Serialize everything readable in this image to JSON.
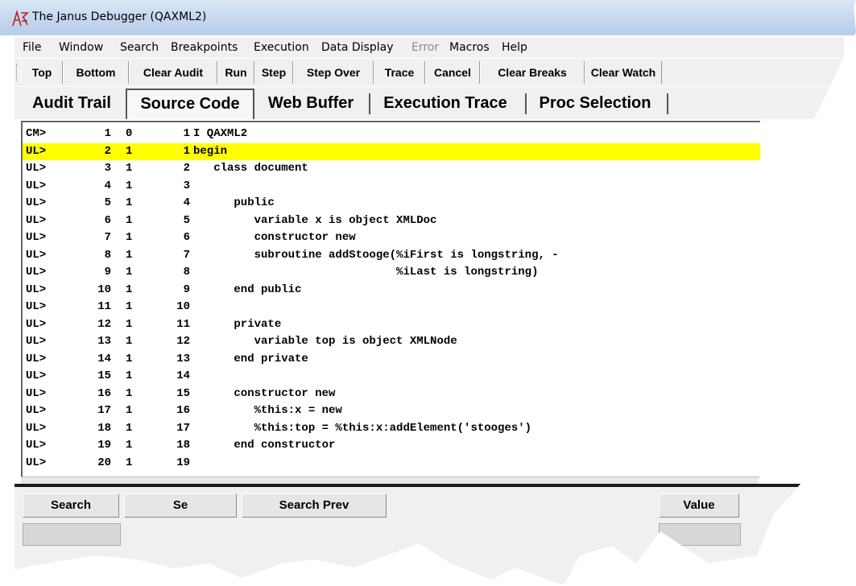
{
  "window": {
    "title": "The Janus Debugger (QAXML2)",
    "icon": "janus-debugger-icon"
  },
  "menu": [
    {
      "label": "File",
      "enabled": true
    },
    {
      "label": "Window",
      "enabled": true
    },
    {
      "label": "Search",
      "enabled": true
    },
    {
      "label": "Breakpoints",
      "enabled": true
    },
    {
      "label": "Execution",
      "enabled": true
    },
    {
      "label": "Data Display",
      "enabled": true
    },
    {
      "label": "Error",
      "enabled": false
    },
    {
      "label": "Macros",
      "enabled": true
    },
    {
      "label": "Help",
      "enabled": true
    }
  ],
  "toolbar": [
    "Top",
    "Bottom",
    "Clear Audit",
    "Run",
    "Step",
    "Step Over",
    "Trace",
    "Cancel",
    "Clear Breaks",
    "Clear Watch"
  ],
  "tabs": {
    "items": [
      "Audit Trail",
      "Source Code",
      "Web Buffer",
      "Execution Trace",
      "Proc Selection"
    ],
    "active": "Source Code"
  },
  "source": {
    "highlight_color": "#ffff00",
    "highlighted_line": 2,
    "lines": [
      [
        "CM>",
        "1",
        "0",
        "1",
        "I QAXML2"
      ],
      [
        "UL>",
        "2",
        "1",
        "1",
        "begin"
      ],
      [
        "UL>",
        "3",
        "1",
        "2",
        "   class document"
      ],
      [
        "UL>",
        "4",
        "1",
        "3",
        ""
      ],
      [
        "UL>",
        "5",
        "1",
        "4",
        "      public"
      ],
      [
        "UL>",
        "6",
        "1",
        "5",
        "         variable x is object XMLDoc"
      ],
      [
        "UL>",
        "7",
        "1",
        "6",
        "         constructor new"
      ],
      [
        "UL>",
        "8",
        "1",
        "7",
        "         subroutine addStooge(%iFirst is longstring, -"
      ],
      [
        "UL>",
        "9",
        "1",
        "8",
        "                              %iLast is longstring)"
      ],
      [
        "UL>",
        "10",
        "1",
        "9",
        "      end public"
      ],
      [
        "UL>",
        "11",
        "1",
        "10",
        ""
      ],
      [
        "UL>",
        "12",
        "1",
        "11",
        "      private"
      ],
      [
        "UL>",
        "13",
        "1",
        "12",
        "         variable top is object XMLNode"
      ],
      [
        "UL>",
        "14",
        "1",
        "13",
        "      end private"
      ],
      [
        "UL>",
        "15",
        "1",
        "14",
        ""
      ],
      [
        "UL>",
        "16",
        "1",
        "15",
        "      constructor new"
      ],
      [
        "UL>",
        "17",
        "1",
        "16",
        "         %this:x = new"
      ],
      [
        "UL>",
        "18",
        "1",
        "17",
        "         %this:top = %this:x:addElement('stooges')"
      ],
      [
        "UL>",
        "19",
        "1",
        "18",
        "      end constructor"
      ],
      [
        "UL>",
        "20",
        "1",
        "19",
        ""
      ]
    ]
  },
  "bottom_buttons": [
    "Search",
    "Se",
    "Search Prev",
    "Value"
  ]
}
